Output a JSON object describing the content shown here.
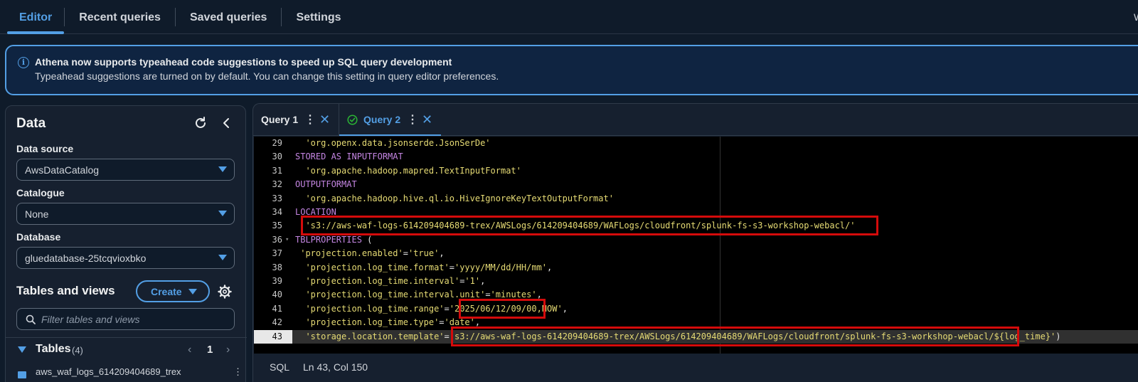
{
  "top_tabs": [
    {
      "label": "Editor",
      "active": true
    },
    {
      "label": "Recent queries",
      "active": false
    },
    {
      "label": "Saved queries",
      "active": false
    },
    {
      "label": "Settings",
      "active": false
    }
  ],
  "top_edge_char": "W",
  "banner": {
    "title": "Athena now supports typeahead code suggestions to speed up SQL query development",
    "description": "Typeahead suggestions are turned on by default. You can change this setting in query editor preferences.",
    "icon": "info-icon"
  },
  "data_panel": {
    "title": "Data",
    "data_source_label": "Data source",
    "data_source_value": "AwsDataCatalog",
    "catalogue_label": "Catalogue",
    "catalogue_value": "None",
    "database_label": "Database",
    "database_value": "gluedatabase-25tcqvioxbko",
    "tables_views_title": "Tables and views",
    "create_label": "Create",
    "filter_placeholder": "Filter tables and views",
    "tables_label": "Tables",
    "tables_count": "(4)",
    "page_number": "1",
    "first_table": "aws_waf_logs_614209404689_trex",
    "row_menu": "⋮"
  },
  "query_tabs": [
    {
      "label": "Query 1",
      "active": false
    },
    {
      "label": "Query 2",
      "active": true
    }
  ],
  "code_lines": [
    {
      "n": "29",
      "parts": [
        {
          "c": "s",
          "t": "  'org.openx.data.jsonserde.JsonSerDe'"
        }
      ]
    },
    {
      "n": "30",
      "parts": [
        {
          "c": "k",
          "t": "STORED AS INPUTFORMAT"
        }
      ]
    },
    {
      "n": "31",
      "parts": [
        {
          "c": "s",
          "t": "  'org.apache.hadoop.mapred.TextInputFormat'"
        }
      ]
    },
    {
      "n": "32",
      "parts": [
        {
          "c": "k",
          "t": "OUTPUTFORMAT"
        }
      ]
    },
    {
      "n": "33",
      "parts": [
        {
          "c": "s",
          "t": "  'org.apache.hadoop.hive.ql.io.HiveIgnoreKeyTextOutputFormat'"
        }
      ]
    },
    {
      "n": "34",
      "parts": [
        {
          "c": "k",
          "t": "LOCATION"
        }
      ]
    },
    {
      "n": "35",
      "parts": [
        {
          "c": "s",
          "t": "  's3://aws-waf-logs-614209404689-trex/AWSLogs/614209404689/WAFLogs/cloudfront/splunk-fs-s3-workshop-webacl/'"
        }
      ]
    },
    {
      "n": "36",
      "fold": true,
      "parts": [
        {
          "c": "k",
          "t": "TBLPROPERTIES"
        },
        {
          "c": "p",
          "t": " ("
        }
      ]
    },
    {
      "n": "37",
      "parts": [
        {
          "c": "s",
          "t": " 'projection.enabled'"
        },
        {
          "c": "p",
          "t": "="
        },
        {
          "c": "s",
          "t": "'true'"
        },
        {
          "c": "p",
          "t": ","
        }
      ]
    },
    {
      "n": "38",
      "parts": [
        {
          "c": "s",
          "t": "  'projection.log_time.format'"
        },
        {
          "c": "p",
          "t": "="
        },
        {
          "c": "s",
          "t": "'yyyy/MM/dd/HH/mm'"
        },
        {
          "c": "p",
          "t": ","
        }
      ]
    },
    {
      "n": "39",
      "parts": [
        {
          "c": "s",
          "t": "  'projection.log_time.interval'"
        },
        {
          "c": "p",
          "t": "="
        },
        {
          "c": "s",
          "t": "'1'"
        },
        {
          "c": "p",
          "t": ","
        }
      ]
    },
    {
      "n": "40",
      "parts": [
        {
          "c": "s",
          "t": "  'projection.log_time.interval.unit'"
        },
        {
          "c": "p",
          "t": "="
        },
        {
          "c": "s",
          "t": "'minutes'"
        },
        {
          "c": "p",
          "t": ","
        }
      ]
    },
    {
      "n": "41",
      "parts": [
        {
          "c": "s",
          "t": "  'projection.log_time.range'"
        },
        {
          "c": "p",
          "t": "="
        },
        {
          "c": "s",
          "t": "'2025/06/12/09/00,NOW'"
        },
        {
          "c": "p",
          "t": ","
        }
      ]
    },
    {
      "n": "42",
      "parts": [
        {
          "c": "s",
          "t": "  'projection.log_time.type'"
        },
        {
          "c": "p",
          "t": "="
        },
        {
          "c": "s",
          "t": "'date'"
        },
        {
          "c": "p",
          "t": ","
        }
      ]
    },
    {
      "n": "43",
      "hl": true,
      "parts": [
        {
          "c": "s",
          "t": "  'storage.location.template'"
        },
        {
          "c": "p",
          "t": "="
        },
        {
          "c": "s",
          "t": "'s3://aws-waf-logs-614209404689-trex/AWSLogs/614209404689/WAFLogs/cloudfront/splunk-fs-s3-workshop-webacl/${log_time}'"
        },
        {
          "c": "p",
          "t": ")"
        }
      ]
    }
  ],
  "status_bar": {
    "language": "SQL",
    "cursor": "Ln 43, Col 150"
  },
  "colors": {
    "accent": "#539fe5",
    "highlight_box": "#d40b0b",
    "keyword": "#c586e3",
    "string": "#e6db74"
  }
}
